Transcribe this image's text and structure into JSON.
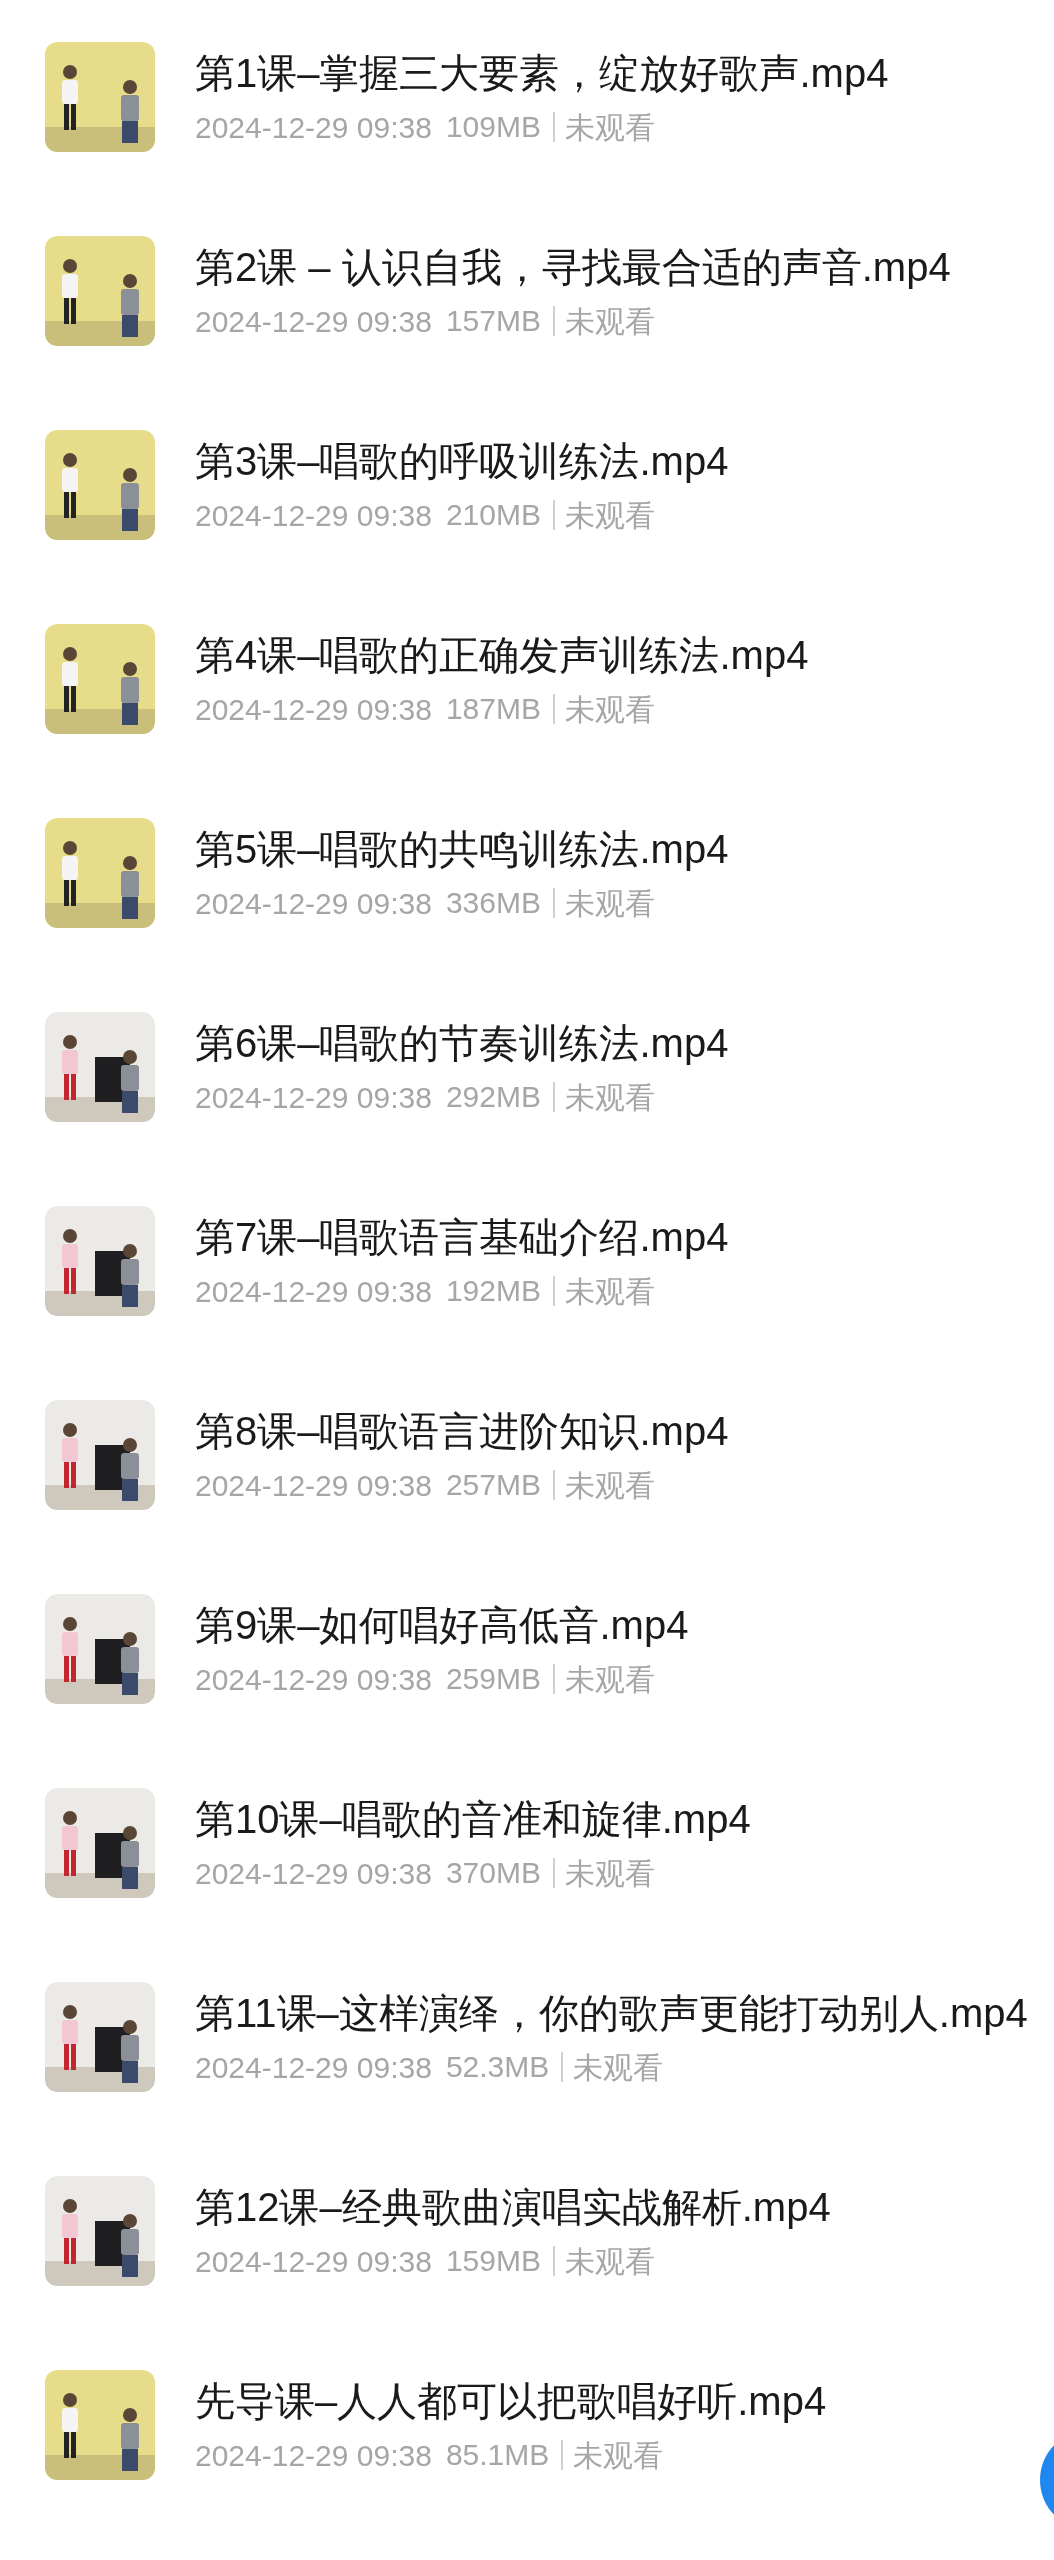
{
  "files": [
    {
      "title": "第1课–掌握三大要素，绽放好歌声.mp4",
      "date": "2024-12-29 09:38",
      "size": "109MB",
      "status": "未观看"
    },
    {
      "title": "第2课 – 认识自我，寻找最合适的声音.mp4",
      "date": "2024-12-29 09:38",
      "size": "157MB",
      "status": "未观看"
    },
    {
      "title": "第3课–唱歌的呼吸训练法.mp4",
      "date": "2024-12-29 09:38",
      "size": "210MB",
      "status": "未观看"
    },
    {
      "title": "第4课–唱歌的正确发声训练法.mp4",
      "date": "2024-12-29 09:38",
      "size": "187MB",
      "status": "未观看"
    },
    {
      "title": "第5课–唱歌的共鸣训练法.mp4",
      "date": "2024-12-29 09:38",
      "size": "336MB",
      "status": "未观看"
    },
    {
      "title": "第6课–唱歌的节奏训练法.mp4",
      "date": "2024-12-29 09:38",
      "size": "292MB",
      "status": "未观看"
    },
    {
      "title": "第7课–唱歌语言基础介绍.mp4",
      "date": "2024-12-29 09:38",
      "size": "192MB",
      "status": "未观看"
    },
    {
      "title": "第8课–唱歌语言进阶知识.mp4",
      "date": "2024-12-29 09:38",
      "size": "257MB",
      "status": "未观看"
    },
    {
      "title": "第9课–如何唱好高低音.mp4",
      "date": "2024-12-29 09:38",
      "size": "259MB",
      "status": "未观看"
    },
    {
      "title": "第10课–唱歌的音准和旋律.mp4",
      "date": "2024-12-29 09:38",
      "size": "370MB",
      "status": "未观看"
    },
    {
      "title": "第11课–这样演绎，你的歌声更能打动别人.mp4",
      "date": "2024-12-29 09:38",
      "size": "52.3MB",
      "status": "未观看"
    },
    {
      "title": "第12课–经典歌曲演唱实战解析.mp4",
      "date": "2024-12-29 09:38",
      "size": "159MB",
      "status": "未观看"
    },
    {
      "title": "先导课–人人都可以把歌唱好听.mp4",
      "date": "2024-12-29 09:38",
      "size": "85.1MB",
      "status": "未观看"
    }
  ]
}
